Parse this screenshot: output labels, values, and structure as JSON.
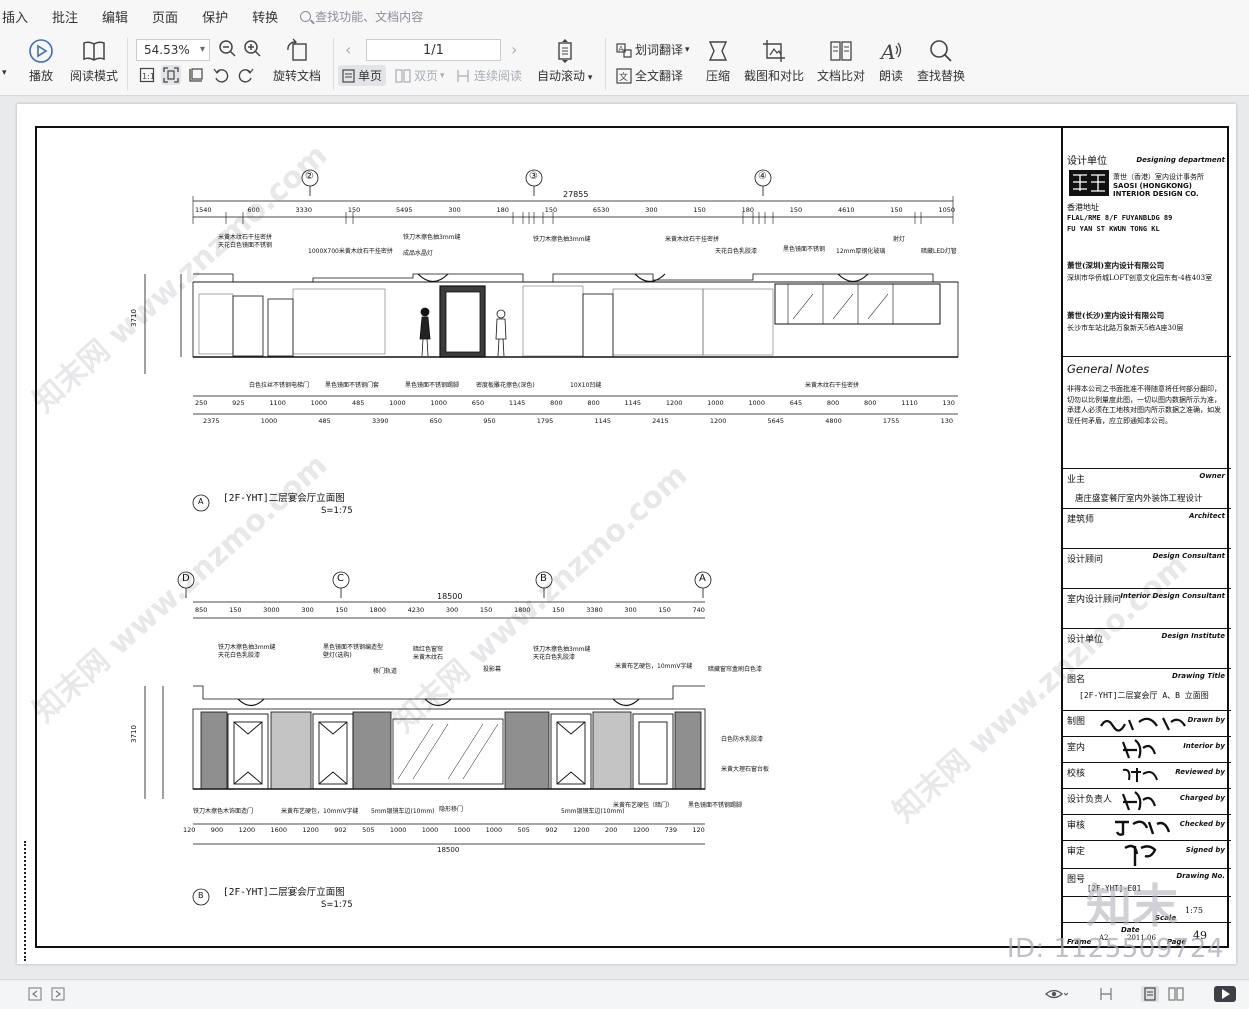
{
  "menu": {
    "items": [
      "插入",
      "批注",
      "编辑",
      "页面",
      "保护",
      "转换"
    ],
    "search_placeholder": "查找功能、文档内容"
  },
  "toolbar": {
    "play": "播放",
    "read_mode": "阅读模式",
    "zoom": "54.53%",
    "rotate": "旋转文档",
    "page_indicator": "1/1",
    "single_page": "单页",
    "double_page": "双页",
    "continuous": "连续阅读",
    "auto_scroll": "自动滚动",
    "word_translate": "划词翻译",
    "full_translate": "全文翻译",
    "compress": "压缩",
    "screenshot_compare": "截图和对比",
    "doc_compare": "文档比对",
    "read_aloud": "朗读",
    "find_replace": "查找替换"
  },
  "drawing": {
    "grid_top": [
      "②",
      "③",
      "④"
    ],
    "grid_bottom": [
      "D",
      "C",
      "B",
      "A"
    ],
    "total_top": "27855",
    "top_dims": [
      "1540",
      "600",
      "3330",
      "150",
      "5495",
      "300",
      "180",
      "150",
      "6530",
      "300",
      "150",
      "180",
      "150",
      "4610",
      "150",
      "1050"
    ],
    "top_subdims": [
      "250",
      "925",
      "1100",
      "1000",
      "485",
      "1000",
      "1000",
      "650",
      "1145",
      "800",
      "800",
      "1145",
      "1200",
      "1000",
      "1000",
      "645",
      "800",
      "800",
      "1110",
      "130"
    ],
    "top_subdims2": [
      "2375",
      "1000",
      "485",
      "3390",
      "650",
      "950",
      "1795",
      "1145",
      "2415",
      "1200",
      "5645",
      "4800",
      "1755",
      "130"
    ],
    "elev_a_title": "[2F-YHT]二层宴会厅立面图",
    "elev_a_scale": "S=1:75",
    "elev_a_mark": "A",
    "total_bottom": "18500",
    "bottom_dims": [
      "850",
      "150",
      "3000",
      "300",
      "150",
      "1800",
      "4230",
      "300",
      "150",
      "1800",
      "150",
      "3380",
      "300",
      "150",
      "740"
    ],
    "bottom_subdims": [
      "120",
      "900",
      "1200",
      "1600",
      "1200",
      "902",
      "505",
      "1000",
      "1000",
      "1000",
      "1000",
      "505",
      "902",
      "1200",
      "200",
      "1200",
      "739",
      "120"
    ],
    "elev_b_title": "[2F-YHT]二层宴会厅立面图",
    "elev_b_scale": "S=1:75",
    "elev_b_mark": "B",
    "height_left_top": "3710",
    "height_left_bottom": "3710",
    "labels_top": [
      "米黄木纹石干挂密拼",
      "天花白色镜面不锈钢",
      "1000X700米黄木纹石干挂密拼",
      "铁刀木擦色抽3mm缝",
      "成品水晶灯",
      "铁刀木擦色抽3mm缝",
      "米黄木纹石干挂密拼",
      "天花白色乳胶漆",
      "黑色镜面不锈钢",
      "12mm厚钢化玻璃",
      "射灯",
      "暗藏LED灯管",
      "白色拉丝不锈钢电梯门",
      "黑色镜面不锈钢门套",
      "黑色镜面不锈钢踢脚",
      "密度板雕花擦色(深色)",
      "10X10凹缝",
      "米黄木纹石干挂密拼"
    ],
    "labels_bottom": [
      "铁刀木擦色抽3mm缝",
      "天花白色乳胶漆",
      "黑色镜面不锈钢编造型",
      "壁灯(选购)",
      "移门轨道",
      "暗红色窗帘",
      "米黄木纹石",
      "投影幕",
      "铁刀木擦色抽3mm缝",
      "天花白色乳胶漆",
      "米黄布艺硬包，10mmV字缝",
      "暗藏窗帘盒刷白色漆",
      "白色防水乳胶漆",
      "米黄大理石窗台板",
      "铁刀木擦色木饰面造门",
      "米黄布艺硬包，10mmV字缝",
      "5mm银镜车边(10mm)",
      "隐形移门",
      "5mm银镜车边(10mm)",
      "米黄布艺硬包（暗门）",
      "黑色镜面不锈钢踢脚"
    ]
  },
  "titleblock": {
    "design_unit": "设计单位",
    "design_unit_en": "Designing department",
    "firm_cn": "萧世（香港）室内设计事务所",
    "firm_en_1": "SAOSI (HONGKONG)",
    "firm_en_2": "INTERIOR DESIGN CO.",
    "hk_addr_label": "香港地址",
    "hk_addr_1": "FLAL/RME 8/F FUYANBLDG 89",
    "hk_addr_2": "FU YAN ST KWUN TONG  KL",
    "sz_firm": "萧世(深圳)室内设计有限公司",
    "sz_addr": "深圳市华侨城LOFT创意文化园东有-4栋403室",
    "cs_firm": "萧世(长沙)室内设计有限公司",
    "cs_addr": "长沙市车站北路万象新天5栋A座30层",
    "general_notes": "General Notes",
    "notes_text": "非得本公司之书面批准不得随意将任何部分翻印，切勿以比例量度此图，一切以图内数据所示为准，承建人必须在工地核对图内所示数据之准确，如发现任何矛盾，应立即通知本公司。",
    "owner_label": "业主",
    "owner_en": "Owner",
    "project": "唐庄盛宴餐厅室内外装饰工程设计",
    "architect": "建筑师",
    "architect_en": "Architect",
    "design_consultant": "设计顾问",
    "design_consultant_en": "Design Consultant",
    "interior_consultant": "室内设计顾问",
    "interior_consultant_en": "Interior Design Consultant",
    "design_institute": "设计单位",
    "design_institute_en": "Design Institute",
    "drawing_title_label": "图名",
    "drawing_title_en": "Drawing Title",
    "drawing_title": "[2F-YHT]二层宴会厅 A、B 立面图",
    "drawn_by": "制图",
    "drawn_by_en": "Drawn by",
    "interior_by": "室内",
    "interior_by_en": "Interior by",
    "reviewed_by": "校核",
    "reviewed_by_en": "Reviewed by",
    "charged_by": "设计负责人",
    "charged_by_en": "Charged by",
    "checked_by": "审核",
    "checked_by_en": "Checked by",
    "signed_by": "审定",
    "signed_by_en": "Signed by",
    "drawing_no_label": "图号",
    "drawing_no_en": "Drawing No.",
    "drawing_no": "[2F-YHT]-E01",
    "scale_value": "1:75",
    "scale_en": "Scale",
    "frame_en": "Frame",
    "frame": "A2",
    "date_en": "Date",
    "date": "2011.06",
    "page_en": "Page",
    "page": "49"
  },
  "watermarks": {
    "site": "知末网 www.znzmo.com",
    "id": "ID: 1125509724",
    "logo": "知末"
  }
}
